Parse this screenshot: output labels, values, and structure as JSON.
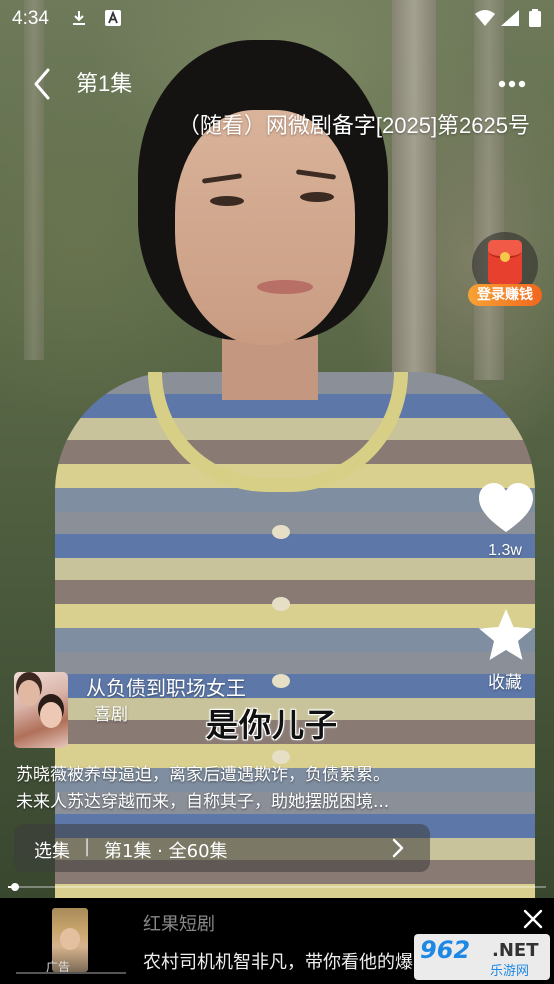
{
  "status_bar": {
    "time": "4:34",
    "icons": [
      "download-icon",
      "a-icon",
      "wifi-icon",
      "signal-icon",
      "battery-icon"
    ]
  },
  "header": {
    "episode_title": "第1集",
    "license": "（随看）网微剧备字[2025]第2625号"
  },
  "actions": {
    "redpacket_label": "登录赚钱",
    "like_count": "1.3w",
    "collect_label": "收藏"
  },
  "drama": {
    "title": "从负债到职场女王",
    "genre": "喜剧",
    "subtitle": "是你儿子",
    "description_line1": "苏晓薇被养母逼迫，离家后遭遇欺诈，负债累累。",
    "description_line2": "未来人苏达穿越而来，自称其子，助她摆脱困境..."
  },
  "episode_bar": {
    "select_label": "选集",
    "separator": "|",
    "info": "第1集 · 全60集"
  },
  "player": {
    "progress": 0.01
  },
  "ad": {
    "tag": "广告",
    "brand": "红果短剧",
    "text": "农村司机机智非凡，带你看他的爆"
  },
  "watermark": {
    "num": "962",
    "net": ".NET",
    "site": "乐游网"
  },
  "colors": {
    "like_icon": "#ffffff",
    "redpacket_label_start": "#f7a233",
    "redpacket_label_end": "#f0671f",
    "watermark_blue": "#1e88e5"
  }
}
